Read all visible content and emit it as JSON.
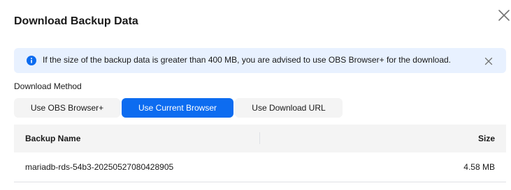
{
  "dialog": {
    "title": "Download Backup Data",
    "close_icon": "close-icon"
  },
  "notice": {
    "icon": "info-icon",
    "text": "If the size of the backup data is greater than 400 MB, you are advised to use OBS Browser+ for the download.",
    "close_icon": "close-icon",
    "color": "#e8f1ff"
  },
  "download_method": {
    "label": "Download Method",
    "options": [
      {
        "label": "Use OBS Browser+",
        "selected": false
      },
      {
        "label": "Use Current Browser",
        "selected": true
      },
      {
        "label": "Use Download URL",
        "selected": false
      }
    ],
    "accent": "#0d6cf0"
  },
  "table": {
    "columns": [
      "Backup Name",
      "Size"
    ],
    "rows": [
      {
        "name": "mariadb-rds-54b3-20250527080428905",
        "size": "4.58 MB"
      }
    ]
  }
}
